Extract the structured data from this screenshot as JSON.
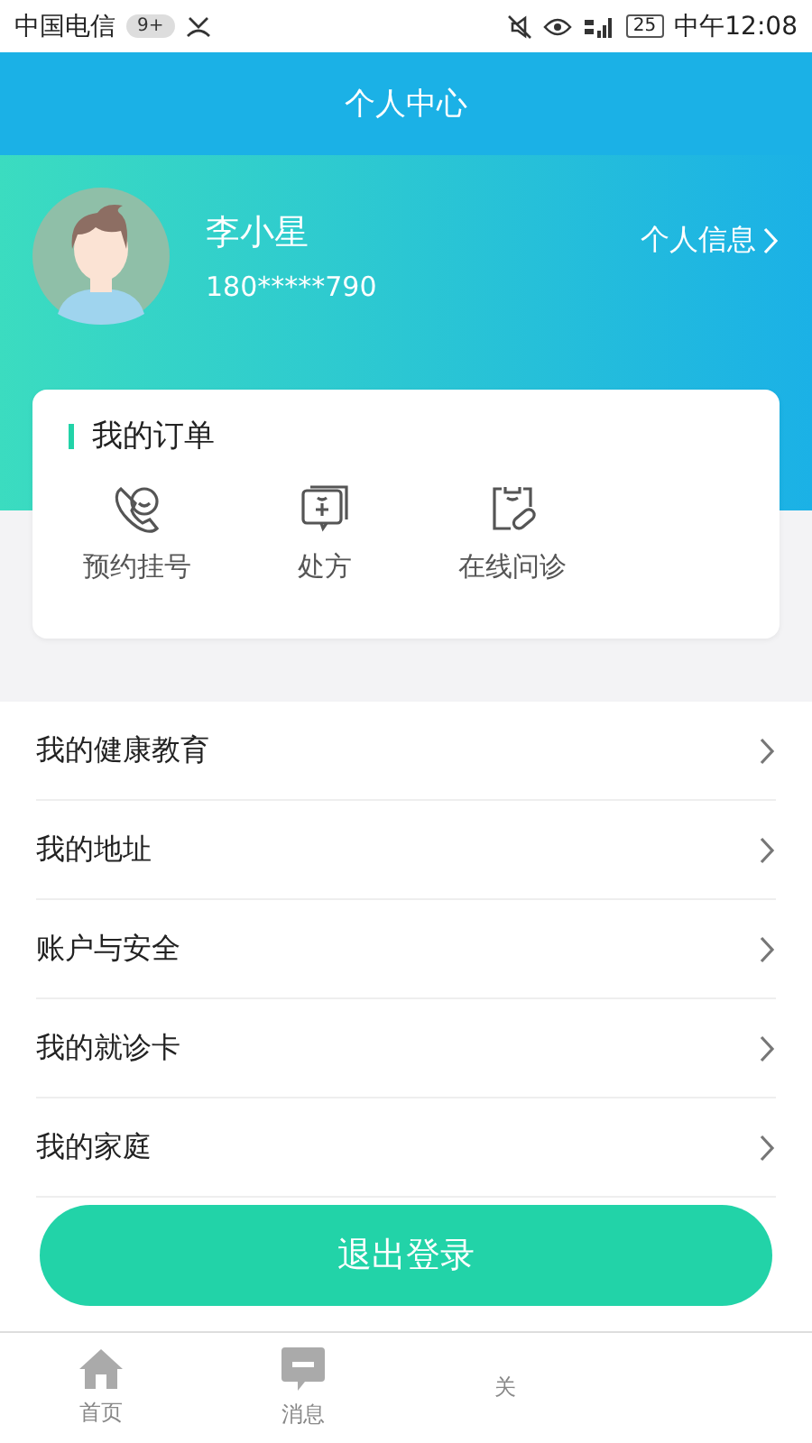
{
  "status_bar": {
    "carrier": "中国电信",
    "badge": "9+",
    "battery": "25",
    "time": "中午12:08"
  },
  "header": {
    "title": "个人中心"
  },
  "profile": {
    "name": "李小星",
    "phone": "180*****790",
    "link": "个人信息"
  },
  "orders": {
    "title": "我的订单",
    "items": [
      {
        "kind": "phone",
        "label": "预约挂号"
      },
      {
        "kind": "prescription",
        "label": "处方"
      },
      {
        "kind": "consult",
        "label": "在线问诊"
      }
    ]
  },
  "menu": [
    {
      "label": "我的健康教育"
    },
    {
      "label": "我的地址"
    },
    {
      "label": "账户与安全"
    },
    {
      "label": "我的就诊卡"
    },
    {
      "label": "我的家庭"
    }
  ],
  "logout": "退出登录",
  "tabs": [
    {
      "kind": "home",
      "label": "首页",
      "selected": false
    },
    {
      "kind": "message",
      "label": "消息",
      "selected": false
    },
    {
      "kind": "other",
      "label": "关",
      "selected": false
    }
  ]
}
